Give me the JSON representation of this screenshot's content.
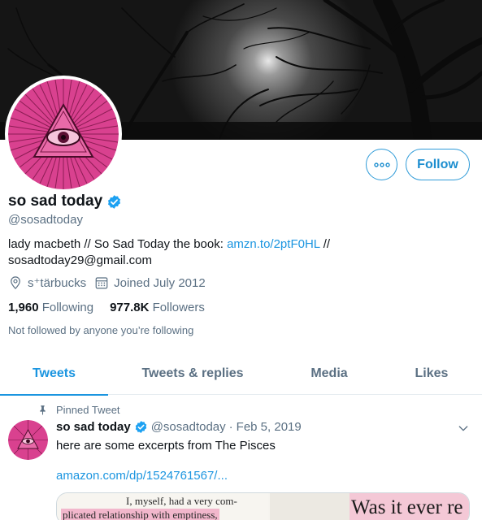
{
  "profile": {
    "display_name": "so sad today",
    "handle": "@sosadtoday",
    "verified": true,
    "bio_text": "lady macbeth // So Sad Today the book: ",
    "bio_link": "amzn.to/2ptF0HL",
    "bio_after": "  //",
    "bio_email": "sosadtoday29@gmail.com",
    "location": "s⁺tärbucks",
    "joined": "Joined July 2012",
    "following_count": "1,960",
    "following_label": "Following",
    "followers_count": "977.8K",
    "followers_label": "Followers",
    "not_followed_text": "Not followed by anyone you’re following"
  },
  "actions": {
    "follow_label": "Follow",
    "more_icon": "more-icon"
  },
  "tabs": [
    {
      "label": "Tweets",
      "active": true
    },
    {
      "label": "Tweets & replies",
      "active": false
    },
    {
      "label": "Media",
      "active": false
    },
    {
      "label": "Likes",
      "active": false
    }
  ],
  "tweet": {
    "pinned_label": "Pinned Tweet",
    "name": "so sad today",
    "handle": "@sosadtoday",
    "separator": "·",
    "date": "Feb 5, 2019",
    "text": "here are some excerpts from The Pisces",
    "link": "amazon.com/dp/1524761567/...",
    "media": {
      "left_line1": "I, myself, had a very com-",
      "left_line2": "plicated relationship with emptiness,",
      "right_text": "Was it ever re"
    }
  },
  "colors": {
    "accent": "#1b95e0",
    "secondary_text": "#5b7083",
    "verified": "#1da1f2",
    "avatar_pink": "#d9418f"
  }
}
